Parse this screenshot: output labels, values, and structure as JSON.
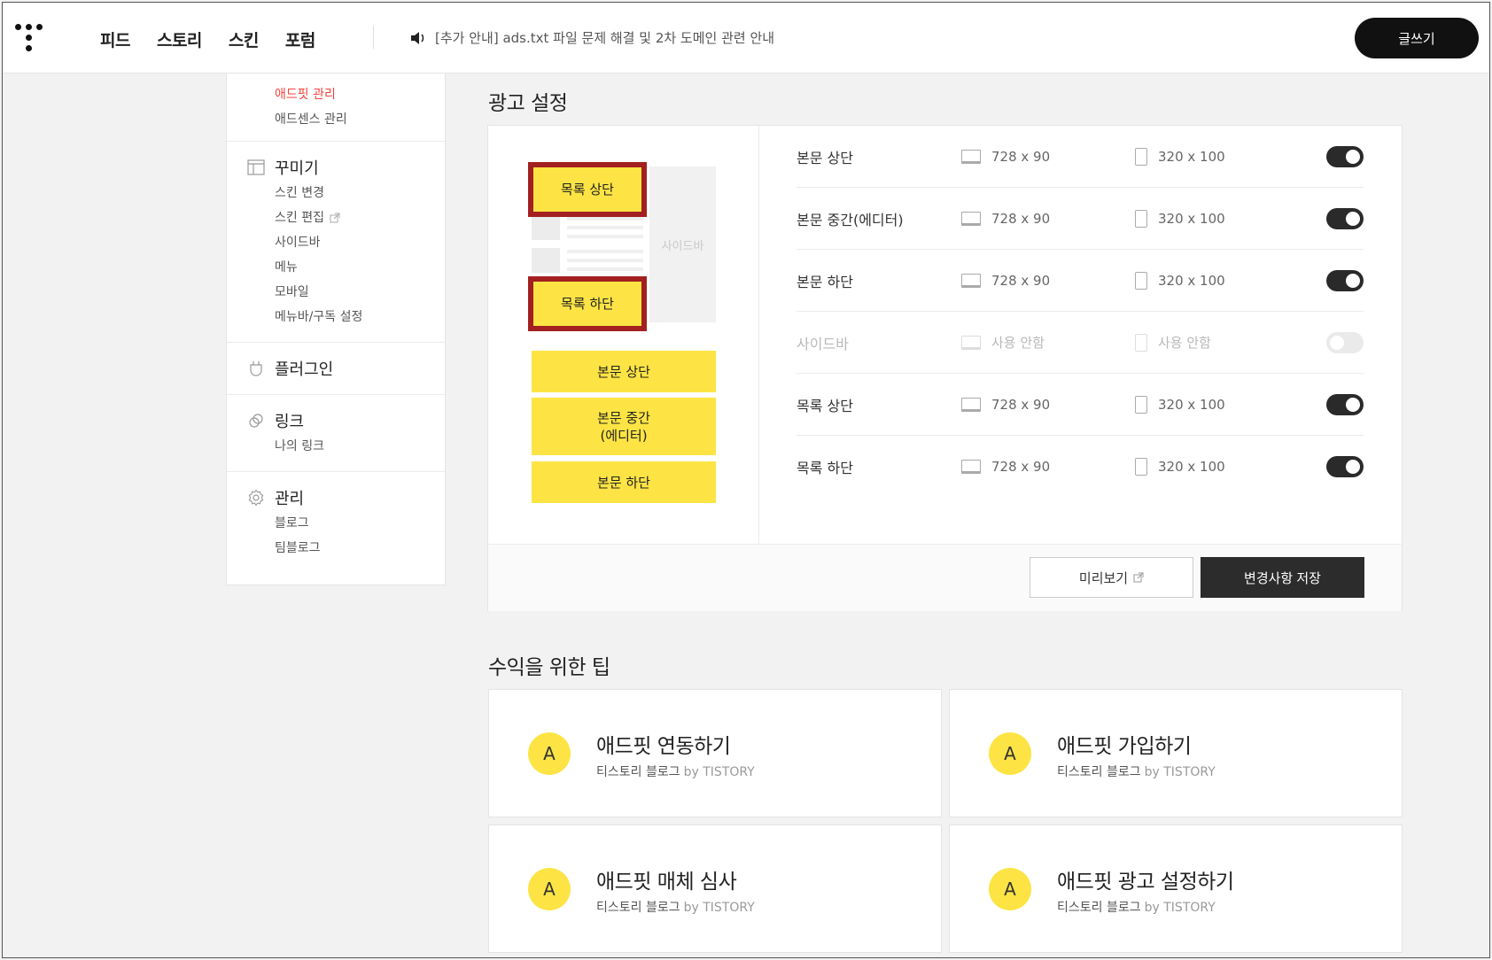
{
  "header": {
    "nav": [
      "피드",
      "스토리",
      "스킨",
      "포럼"
    ],
    "notice": "[추가 안내] ads.txt 파일 문제 해결 및 2차 도메인 관련 안내",
    "write_label": "글쓰기"
  },
  "sidebar": {
    "top_items": [
      {
        "label": "애드핏 관리",
        "active": true
      },
      {
        "label": "애드센스 관리",
        "active": false
      }
    ],
    "groups": [
      {
        "title": "꾸미기",
        "icon": "layout-icon",
        "items": [
          "스킨 변경",
          "스킨 편집",
          "사이드바",
          "메뉴",
          "모바일",
          "메뉴바/구독 설정"
        ]
      },
      {
        "title": "플러그인",
        "icon": "plugin-icon",
        "items": []
      },
      {
        "title": "링크",
        "icon": "link-icon",
        "items": [
          "나의 링크"
        ]
      },
      {
        "title": "관리",
        "icon": "gear-icon",
        "items": [
          "블로그",
          "팀블로그"
        ]
      }
    ]
  },
  "ad_settings": {
    "title": "광고 설정",
    "preview": {
      "sidebar_label": "사이드바",
      "list_top": "목록 상단",
      "list_bottom": "목록 하단",
      "body_top": "본문 상단",
      "body_mid_line1": "본문 중간",
      "body_mid_line2": "(에디터)",
      "body_bottom": "본문 하단"
    },
    "rows": [
      {
        "label": "본문 상단",
        "pc": "728 x 90",
        "mobile": "320 x 100",
        "enabled": true
      },
      {
        "label": "본문 중간(에디터)",
        "pc": "728 x 90",
        "mobile": "320 x 100",
        "enabled": true
      },
      {
        "label": "본문 하단",
        "pc": "728 x 90",
        "mobile": "320 x 100",
        "enabled": true
      },
      {
        "label": "사이드바",
        "pc": "사용 안함",
        "mobile": "사용 안함",
        "enabled": false
      },
      {
        "label": "목록 상단",
        "pc": "728 x 90",
        "mobile": "320 x 100",
        "enabled": true
      },
      {
        "label": "목록 하단",
        "pc": "728 x 90",
        "mobile": "320 x 100",
        "enabled": true
      }
    ],
    "preview_button": "미리보기",
    "save_button": "변경사항 저장"
  },
  "tips": {
    "title": "수익을 위한 팁",
    "cards": [
      {
        "avatar": "A",
        "title": "애드핏 연동하기",
        "source": "티스토리 블로그",
        "by": "by TISTORY"
      },
      {
        "avatar": "A",
        "title": "애드핏 가입하기",
        "source": "티스토리 블로그",
        "by": "by TISTORY"
      },
      {
        "avatar": "A",
        "title": "애드핏 매체 심사",
        "source": "티스토리 블로그",
        "by": "by TISTORY"
      },
      {
        "avatar": "A",
        "title": "애드핏 광고 설정하기",
        "source": "티스토리 블로그",
        "by": "by TISTORY"
      }
    ]
  },
  "colors": {
    "accent_yellow": "#fde444",
    "highlight_red": "#a32020",
    "active_red": "#f1453d",
    "dark": "#2c2c2c"
  }
}
